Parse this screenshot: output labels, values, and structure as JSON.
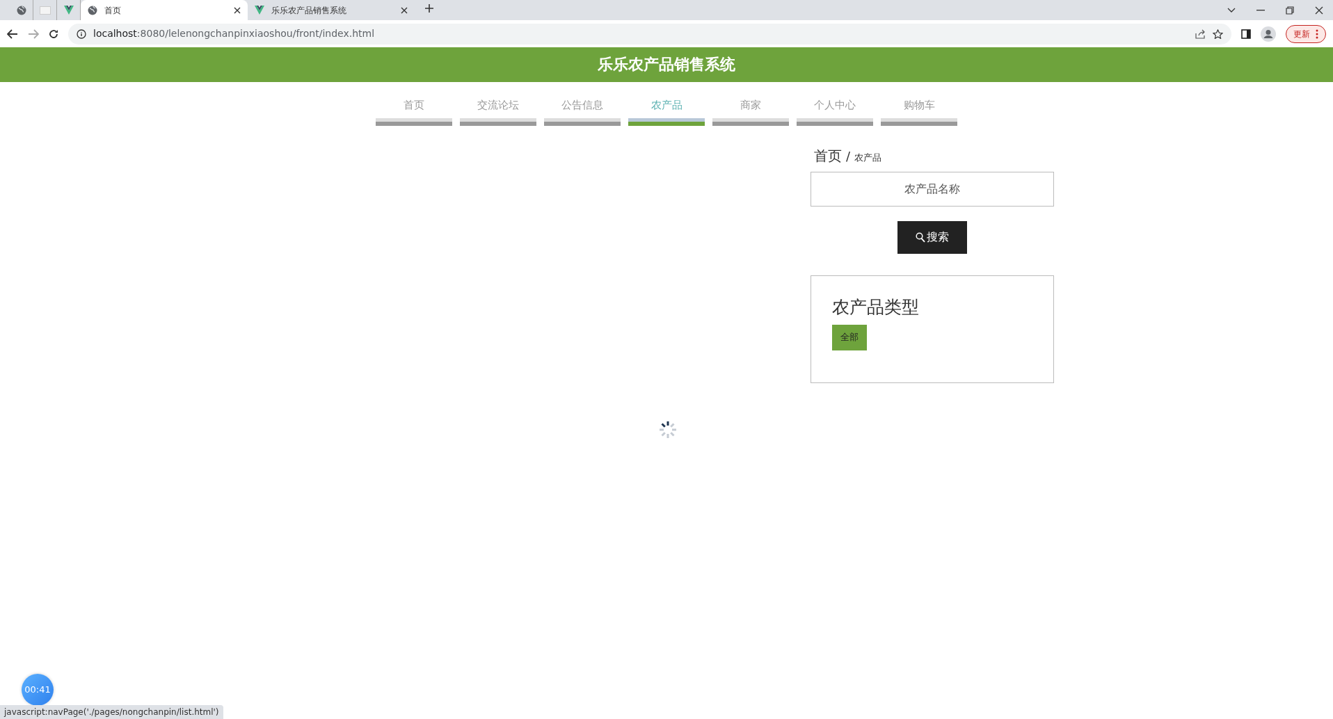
{
  "browser": {
    "tabs": [
      {
        "kind": "pinned-globe",
        "selected": false
      },
      {
        "kind": "pinned-blank",
        "selected": false
      },
      {
        "kind": "pinned-vue",
        "selected": false
      },
      {
        "kind": "page-globe",
        "title": "首页",
        "selected": true
      },
      {
        "kind": "page-vue",
        "title": "乐乐农产品销售系统",
        "selected": false
      }
    ],
    "url_host": "localhost",
    "url_rest": ":8080/lelenongchanpinxiaoshou/front/index.html",
    "update_button": "更新"
  },
  "site_title": "乐乐农产品销售系统",
  "nav": [
    {
      "label": "首页",
      "selected": false
    },
    {
      "label": "交流论坛",
      "selected": false
    },
    {
      "label": "公告信息",
      "selected": false
    },
    {
      "label": "农产品",
      "selected": true
    },
    {
      "label": "商家",
      "selected": false
    },
    {
      "label": "个人中心",
      "selected": false
    },
    {
      "label": "购物车",
      "selected": false
    }
  ],
  "breadcrumb": {
    "home": "首页",
    "separator": "/",
    "current": "农产品"
  },
  "search": {
    "placeholder": "农产品名称",
    "button": "搜索"
  },
  "category_panel": {
    "title": "农产品类型",
    "items": [
      {
        "label": "全部",
        "selected": true
      }
    ]
  },
  "timer": "00:41",
  "status_url": "javascript:navPage('./pages/nongchanpin/list.html')"
}
